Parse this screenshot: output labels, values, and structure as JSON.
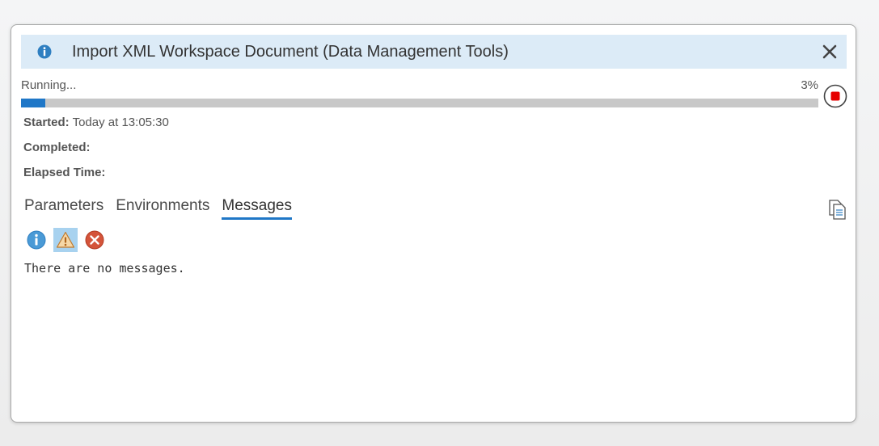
{
  "dialog": {
    "title": "Import XML Workspace Document (Data Management Tools)",
    "title_icon": "info-icon",
    "close_icon": "close-icon",
    "header_color": "#dcebf7"
  },
  "progress": {
    "status": "Running...",
    "percent_label": "3%",
    "percent": 3,
    "bar_color": "#1f77c7",
    "stop_icon": "stop-icon",
    "stop_color": "#e60000"
  },
  "details": {
    "started_label": "Started:",
    "started_value": "Today at 13:05:30",
    "completed_label": "Completed:",
    "completed_value": "",
    "elapsed_label": "Elapsed Time:",
    "elapsed_value": ""
  },
  "tabs": [
    {
      "label": "Parameters",
      "active": false
    },
    {
      "label": "Environments",
      "active": false
    },
    {
      "label": "Messages",
      "active": true
    }
  ],
  "toolbar": {
    "copy_icon": "copy-messages-icon"
  },
  "filters": [
    {
      "icon": "info-filter-icon",
      "selected": false
    },
    {
      "icon": "warning-filter-icon",
      "selected": true
    },
    {
      "icon": "error-filter-icon",
      "selected": false
    }
  ],
  "messages": {
    "empty_text": "There are no messages."
  }
}
